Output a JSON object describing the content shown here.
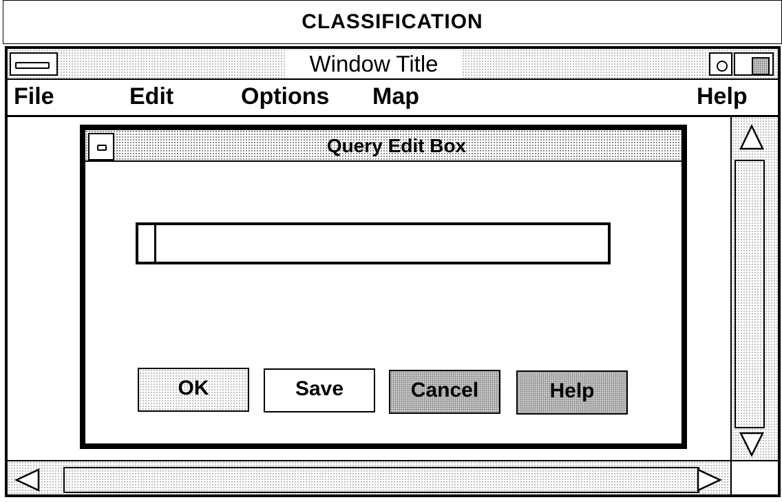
{
  "classification": "CLASSIFICATION",
  "window": {
    "title": "Window Title"
  },
  "menubar": {
    "file": "File",
    "edit": "Edit",
    "options": "Options",
    "map": "Map",
    "help": "Help"
  },
  "dialog": {
    "title": "Query Edit Box",
    "query_input": {
      "value": "",
      "placeholder": ""
    },
    "buttons": {
      "ok": "OK",
      "save": "Save",
      "cancel": "Cancel",
      "help": "Help"
    }
  },
  "icons": {
    "window_menu": "system-menu-icon",
    "minimize": "minimize-icon",
    "maximize": "maximize-icon",
    "scroll_up": "triangle-up-icon",
    "scroll_down": "triangle-down-icon",
    "scroll_left": "triangle-left-icon",
    "scroll_right": "triangle-right-icon"
  }
}
